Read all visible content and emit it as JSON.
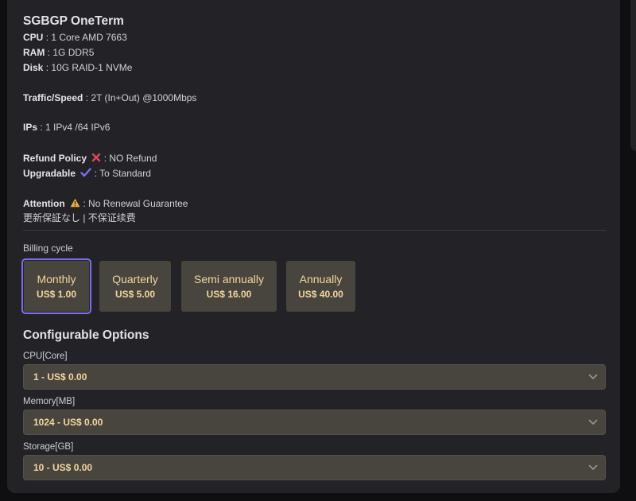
{
  "product": {
    "title": "SGBGP OneTerm",
    "specs": {
      "cpu_label": "CPU",
      "cpu_value": "1 Core AMD 7663",
      "ram_label": "RAM",
      "ram_value": "1G DDR5",
      "disk_label": "Disk",
      "disk_value": "10G RAID-1 NVMe",
      "traffic_label": "Traffic/Speed",
      "traffic_value": "2T (In+Out) @1000Mbps",
      "ips_label": "IPs",
      "ips_value": "1 IPv4 /64 IPv6",
      "refund_label": "Refund Policy",
      "refund_value": "NO Refund",
      "upgradable_label": "Upgradable",
      "upgradable_value": "To Standard",
      "attention_label": "Attention",
      "attention_value": "No Renewal Guarantee",
      "attention_note": "更新保証なし | 不保证续费",
      "separator": ":"
    },
    "icons": {
      "refund": "cross-mark-icon",
      "upgradable": "check-mark-icon",
      "attention": "warning-icon"
    }
  },
  "billing": {
    "label": "Billing cycle",
    "selected": "Monthly",
    "cycles": [
      {
        "name": "Monthly",
        "price": "US$ 1.00"
      },
      {
        "name": "Quarterly",
        "price": "US$ 5.00"
      },
      {
        "name": "Semi annually",
        "price": "US$ 16.00"
      },
      {
        "name": "Annually",
        "price": "US$ 40.00"
      }
    ]
  },
  "config": {
    "title": "Configurable Options",
    "options": [
      {
        "label": "CPU[Core]",
        "value": "1 - US$ 0.00"
      },
      {
        "label": "Memory[MB]",
        "value": "1024 - US$ 0.00"
      },
      {
        "label": "Storage[GB]",
        "value": "10 - US$ 0.00"
      }
    ]
  },
  "colors": {
    "panel_bg": "#232327",
    "button_bg": "#48443e",
    "accent_text": "#f2d8a0",
    "selected_border": "#7b6ff0",
    "cross": "#e0455a",
    "check": "#7b6ff0",
    "warning": "#f0b040"
  }
}
